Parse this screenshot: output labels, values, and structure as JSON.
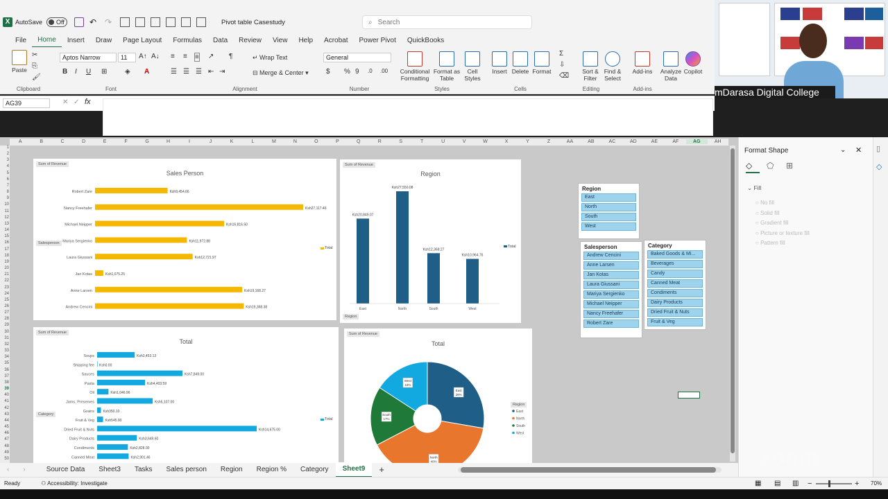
{
  "titlebar": {
    "autosave_label": "AutoSave",
    "autosave_state": "Off",
    "doc_title": "Pivot table Casestudy",
    "search_placeholder": "Search"
  },
  "menu": [
    "File",
    "Home",
    "Insert",
    "Draw",
    "Page Layout",
    "Formulas",
    "Data",
    "Review",
    "View",
    "Help",
    "Acrobat",
    "Power Pivot",
    "QuickBooks"
  ],
  "ribbon": {
    "clipboard": {
      "paste": "Paste",
      "label": "Clipboard"
    },
    "font": {
      "name": "Aptos Narrow",
      "size": "11",
      "label": "Font"
    },
    "alignment": {
      "wrap": "Wrap Text",
      "merge": "Merge & Center",
      "label": "Alignment"
    },
    "number": {
      "format": "General",
      "label": "Number"
    },
    "styles": {
      "conditional_1": "Conditional",
      "conditional_2": "Formatting",
      "format_table_1": "Format as",
      "format_table_2": "Table",
      "cell_styles_1": "Cell",
      "cell_styles_2": "Styles",
      "label": "Styles"
    },
    "cells": {
      "insert": "Insert",
      "delete": "Delete",
      "format": "Format",
      "label": "Cells"
    },
    "editing": {
      "sort_1": "Sort &",
      "sort_2": "Filter",
      "find_1": "Find &",
      "find_2": "Select",
      "label": "Editing"
    },
    "addins": {
      "addins": "Add-ins",
      "label": "Add-ins"
    },
    "analyze_1": "Analyze",
    "analyze_2": "Data",
    "copilot": "Copilot"
  },
  "namebox": "AG39",
  "columns": [
    "A",
    "B",
    "C",
    "D",
    "E",
    "F",
    "G",
    "H",
    "I",
    "J",
    "K",
    "L",
    "M",
    "N",
    "O",
    "P",
    "Q",
    "R",
    "S",
    "T",
    "U",
    "V",
    "W",
    "X",
    "Y",
    "Z",
    "AA",
    "AB",
    "AC",
    "AD",
    "AE",
    "AF",
    "AG",
    "AH"
  ],
  "charts": {
    "salesperson": {
      "tag": "Sum of Revenue",
      "title": "Sales Person",
      "filter_tag": "Salesperson",
      "legend": "Total"
    },
    "region": {
      "tag": "Sum of Revenue",
      "title": "Region",
      "filter_tag": "Region",
      "legend": "Total"
    },
    "category": {
      "tag": "Sum of Revenue",
      "title": "Total",
      "filter_tag": "Category",
      "legend": "Total"
    },
    "pie": {
      "tag": "Sum of Revenue",
      "title": "Total",
      "legend_title": "Region"
    }
  },
  "chart_data": [
    {
      "type": "bar",
      "categories": [
        "Robert Zare",
        "Nancy Freehafer",
        "Michael Neipper",
        "Mariya Sergienko",
        "Laura Giussani",
        "Jan Kotas",
        "Anne Larsen",
        "Andrew Cencini"
      ],
      "values": [
        9454.66,
        27117.46,
        16816.5,
        11972.88,
        12721.97,
        1075.25,
        19168.27,
        19368.38
      ],
      "labels": [
        "Ksh9,454.66",
        "Ksh27,117.46",
        "Ksh16,816.50",
        "Ksh11,972.88",
        "Ksh12,721.97",
        "Ksh1,075.25",
        "Ksh19,168.27",
        "Ksh19,368.38"
      ],
      "title": "Sales Person"
    },
    {
      "type": "bar",
      "categories": [
        "East",
        "North",
        "South",
        "West"
      ],
      "values": [
        20849.07,
        27550.08,
        12368.27,
        10964.76
      ],
      "labels": [
        "Ksh20,849.07",
        "Ksh27,550.08",
        "Ksh12,368.27",
        "Ksh10,964.76"
      ],
      "title": "Region"
    },
    {
      "type": "bar",
      "categories": [
        "Soups",
        "Shipping fee",
        "Sauces",
        "Pasta",
        "Oil",
        "Jams, Preserves",
        "Grains",
        "Fruit & Veg",
        "Dried Fruit & Nuts",
        "Dairy Products",
        "Condiments",
        "Canned Meat"
      ],
      "values": [
        3453.13,
        0,
        7849,
        4403.59,
        1046.96,
        5107,
        350.1,
        545.9,
        14675,
        3649.6,
        2828,
        2901.46
      ],
      "labels": [
        "Ksh3,453.13",
        "Ksh0.00",
        "Ksh7,849.00",
        "Ksh4,403.59",
        "Ksh1,046.96",
        "Ksh5,107.00",
        "Ksh350.10",
        "Ksh545.90",
        "Ksh14,675.00",
        "Ksh3,649.60",
        "Ksh2,828.00",
        "Ksh2,901.46"
      ],
      "title": "Total"
    },
    {
      "type": "pie",
      "categories": [
        "East",
        "North",
        "South",
        "West"
      ],
      "values": [
        28,
        40,
        17,
        16
      ],
      "labels": [
        "East 28%",
        "North 40%",
        "South 17%",
        "West 16%"
      ],
      "title": "Total"
    }
  ],
  "slicers": {
    "region": {
      "title": "Region",
      "items": [
        "East",
        "North",
        "South",
        "West"
      ]
    },
    "salesperson": {
      "title": "Salesperson",
      "items": [
        "Andrew Cencini",
        "Anne Larsen",
        "Jan Kotas",
        "Laura Giussani",
        "Mariya Sergienko",
        "Michael Neipper",
        "Nancy Freehafer",
        "Robert Zare"
      ]
    },
    "category": {
      "title": "Category",
      "items": [
        "Baked Goods & Mi...",
        "Beverages",
        "Candy",
        "Canned Meat",
        "Condiments",
        "Dairy Products",
        "Dried Fruit & Nuts",
        "Fruit & Veg"
      ]
    }
  },
  "format_pane": {
    "title": "Format Shape",
    "section": "Fill",
    "options": [
      "No fill",
      "Solid fill",
      "Gradient fill",
      "Picture or texture fill",
      "Pattern fill"
    ]
  },
  "tabs": [
    "Source Data",
    "Sheet3",
    "Tasks",
    "Sales person",
    "Region",
    "Region %",
    "Category",
    "Sheet9"
  ],
  "status": {
    "ready": "Ready",
    "accessibility": "Accessibility: Investigate",
    "zoom": "70%"
  },
  "video": {
    "caption": "mDarasa Digital College",
    "watermark": "zoom"
  },
  "colors": {
    "accent": "#1e7145",
    "gold": "#f5b800",
    "navy": "#1f5f87",
    "cyan": "#12a8e0",
    "orange": "#e8762d",
    "green": "#1f7a3a"
  }
}
